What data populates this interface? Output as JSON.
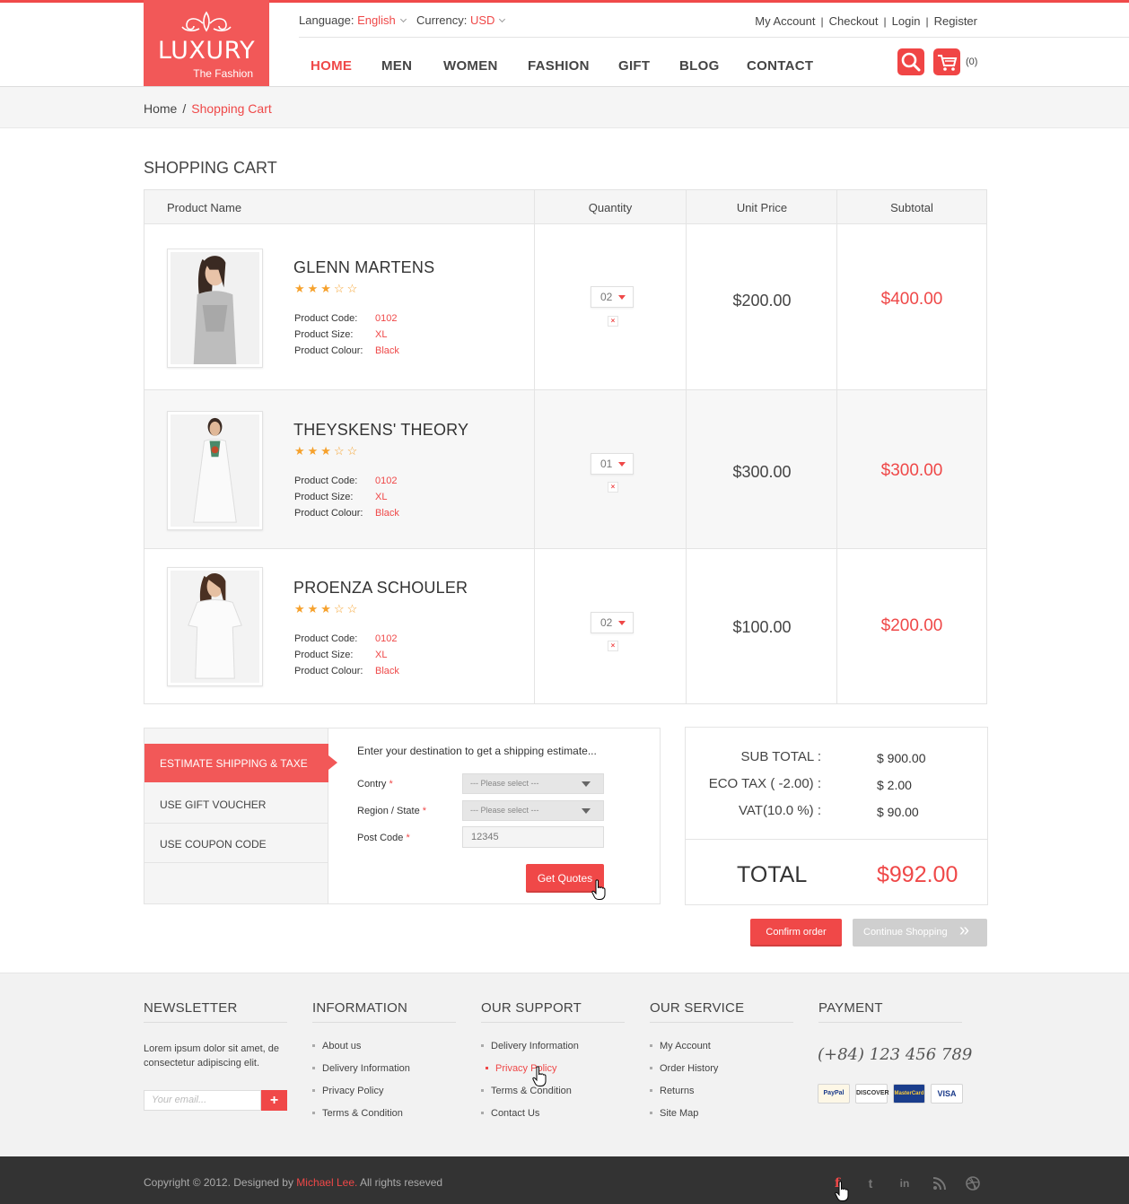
{
  "brand": {
    "name": "LUXURY",
    "tagline": "The Fashion"
  },
  "topbar": {
    "language_label": "Language:",
    "language_value": "English",
    "currency_label": "Currency:",
    "currency_value": "USD",
    "links": [
      "My Account",
      "Checkout",
      "Login",
      "Register"
    ]
  },
  "nav": [
    "HOME",
    "MEN",
    "WOMEN",
    "FASHION",
    "GIFT",
    "BLOG",
    "CONTACT"
  ],
  "cart_count": "(0)",
  "breadcrumb": {
    "home": "Home",
    "sep": "/",
    "current": "Shopping Cart"
  },
  "page_title": "SHOPPING CART",
  "table": {
    "headers": [
      "Product Name",
      "Quantity",
      "Unit Price",
      "Subtotal"
    ],
    "attr_labels": [
      "Product Code:",
      "Product Size:",
      "Product Colour:"
    ],
    "remove_glyph": "×",
    "rows": [
      {
        "name": "GLENN MARTENS",
        "stars": "★★★☆☆",
        "code": "0102",
        "size": "XL",
        "colour": "Black",
        "qty": "02",
        "unit_price": "$200.00",
        "subtotal": "$400.00"
      },
      {
        "name": "THEYSKENS' THEORY",
        "stars": "★★★☆☆",
        "code": "0102",
        "size": "XL",
        "colour": "Black",
        "qty": "01",
        "unit_price": "$300.00",
        "subtotal": "$300.00"
      },
      {
        "name": "PROENZA SCHOULER",
        "stars": "★★★☆☆",
        "code": "0102",
        "size": "XL",
        "colour": "Black",
        "qty": "02",
        "unit_price": "$100.00",
        "subtotal": "$200.00"
      }
    ]
  },
  "shipping": {
    "tabs": [
      "ESTIMATE SHIPPING & TAXE",
      "USE GIFT VOUCHER",
      "USE COUPON CODE"
    ],
    "intro": "Enter your destination to get a shipping estimate...",
    "country_label": "Contry",
    "region_label": "Region / State",
    "postcode_label": "Post Code",
    "required_mark": "*",
    "select_placeholder": "--- Please select ---",
    "postcode_value": "12345",
    "button": "Get Quotes"
  },
  "totals": {
    "subtotal_label": "SUB TOTAL :",
    "subtotal": "$ 900.00",
    "eco_label": "ECO TAX ( -2.00) :",
    "eco": "$ 2.00",
    "vat_label": "VAT(10.0 %) :",
    "vat": "$ 90.00",
    "total_label": "TOTAL",
    "total": "$992.00"
  },
  "actions": {
    "confirm": "Confirm order",
    "continue": "Continue Shopping",
    "continue_arrow": "»"
  },
  "footer": {
    "newsletter": {
      "title": "NEWSLETTER",
      "text": "Lorem ipsum dolor sit amet, de consectetur adipiscing elit.",
      "placeholder": "Your email...",
      "submit": "+"
    },
    "information": {
      "title": "INFORMATION",
      "links": [
        "About us",
        "Delivery Information",
        "Privacy Policy",
        "Terms & Condition"
      ]
    },
    "support": {
      "title": "OUR SUPPORT",
      "links": [
        "Delivery Information",
        "Privacy Policy",
        "Terms & Condition",
        "Contact Us"
      ]
    },
    "service": {
      "title": "OUR SERVICE",
      "links": [
        "My Account",
        "Order History",
        "Returns",
        "Site Map"
      ]
    },
    "payment": {
      "title": "PAYMENT",
      "phone": "(+84) 123 456 789",
      "cards": [
        "PayPal",
        "DISCOVER",
        "MasterCard",
        "VISA"
      ]
    }
  },
  "copyright": {
    "before": "Copyright © 2012. Designed by ",
    "author": "Michael Lee.",
    "after": " All rights reseved"
  },
  "social": [
    "f",
    "t",
    "in",
    "rss",
    "dribbble"
  ],
  "colors": {
    "accent": "#f04848",
    "dark": "#333333"
  }
}
